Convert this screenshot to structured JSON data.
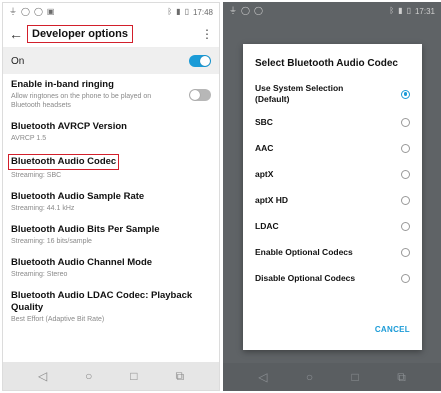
{
  "left": {
    "status": {
      "left_icons": [
        "usb-icon",
        "circle-icon",
        "circle-icon",
        "image-icon"
      ],
      "time": "17:48"
    },
    "toolbar": {
      "back": "←",
      "title": "Developer options",
      "menu": "⋮"
    },
    "on_label": "On",
    "items": [
      {
        "title": "Enable in-band ringing",
        "subtitle": "Allow ringtones on the phone to be played on Bluetooth headsets"
      },
      {
        "title": "Bluetooth AVRCP Version",
        "subtitle": "AVRCP 1.5"
      },
      {
        "title": "Bluetooth Audio Codec",
        "subtitle": "Streaming: SBC"
      },
      {
        "title": "Bluetooth Audio Sample Rate",
        "subtitle": "Streaming: 44.1 kHz"
      },
      {
        "title": "Bluetooth Audio Bits Per Sample",
        "subtitle": "Streaming: 16 bits/sample"
      },
      {
        "title": "Bluetooth Audio Channel Mode",
        "subtitle": "Streaming: Stereo"
      },
      {
        "title": "Bluetooth Audio LDAC Codec: Playback Quality",
        "subtitle": "Best Effort (Adaptive Bit Rate)"
      }
    ],
    "nav": {
      "back": "◁",
      "home": "○",
      "recent": "□",
      "extra": "⧉"
    }
  },
  "right": {
    "status": {
      "time": "17:31"
    },
    "dialog": {
      "title": "Select Bluetooth Audio Codec",
      "options": [
        "Use System Selection (Default)",
        "SBC",
        "AAC",
        "aptX",
        "aptX HD",
        "LDAC",
        "Enable Optional Codecs",
        "Disable Optional Codecs"
      ],
      "selected_index": 0,
      "cancel": "CANCEL"
    },
    "nav": {
      "back": "◁",
      "home": "○",
      "recent": "□",
      "extra": "⧉"
    }
  },
  "colors": {
    "accent": "#1b9bd7",
    "highlight": "#d21f2b"
  }
}
